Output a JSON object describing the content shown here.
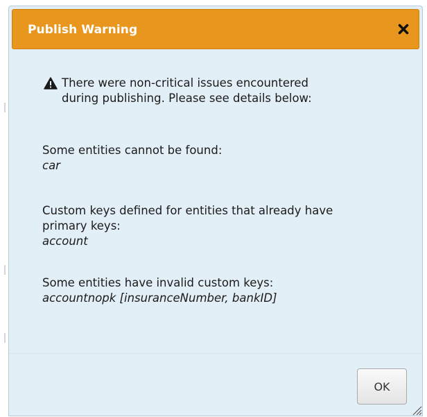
{
  "dialog": {
    "title": "Publish Warning",
    "close_icon": "close-icon",
    "warning_icon": "warning-icon",
    "warning_text_line1": "There were non-critical issues encountered",
    "warning_text_line2": "during publishing. Please see details below:",
    "sections": [
      {
        "label": "Some entities cannot be found:",
        "value": "car"
      },
      {
        "label_line1": "Custom keys defined for entities that already have",
        "label_line2": "primary keys:",
        "value": "account"
      },
      {
        "label": "Some entities have invalid custom keys:",
        "value": "accountnopk [insuranceNumber, bankID]"
      }
    ],
    "ok_label": "OK",
    "resize_icon": "resize-grip-icon"
  },
  "colors": {
    "title_bar": "#e8961e",
    "dialog_background": "#e3eff7",
    "text": "#1b1b1b"
  }
}
